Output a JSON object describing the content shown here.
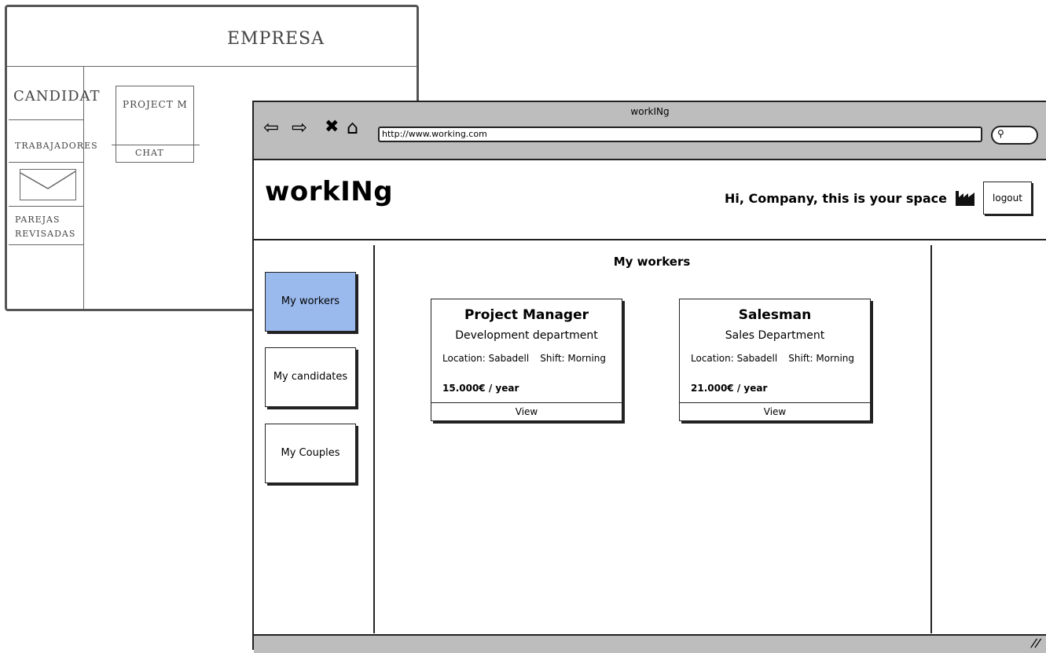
{
  "sketch": {
    "header": "EMPRESA",
    "menu": [
      "CANDIDAT",
      "TRABAJADORES",
      "PAREJAS REVISADAS"
    ],
    "card_title": "PROJECT M",
    "card_button": "CHAT"
  },
  "browser": {
    "window_title": "workINg",
    "url": "http://www.working.com"
  },
  "header": {
    "logo": "workINg",
    "greeting": "Hi, Company, this is your space",
    "logout": "logout"
  },
  "sidebar": {
    "items": [
      {
        "label": "My workers",
        "active": true
      },
      {
        "label": "My candidates",
        "active": false
      },
      {
        "label": "My Couples",
        "active": false
      }
    ]
  },
  "main": {
    "title": "My workers",
    "cards": [
      {
        "title": "Project Manager",
        "department": "Development department",
        "location": "Location: Sabadell",
        "shift": "Shift: Morning",
        "salary": "15.000€ / year",
        "button": "View"
      },
      {
        "title": "Salesman",
        "department": "Sales Department",
        "location": "Location: Sabadell",
        "shift": "Shift: Morning",
        "salary": "21.000€ / year",
        "button": "View"
      }
    ]
  },
  "colors": {
    "active_nav": "#9ab9ec",
    "chrome": "#bdbdbd"
  }
}
